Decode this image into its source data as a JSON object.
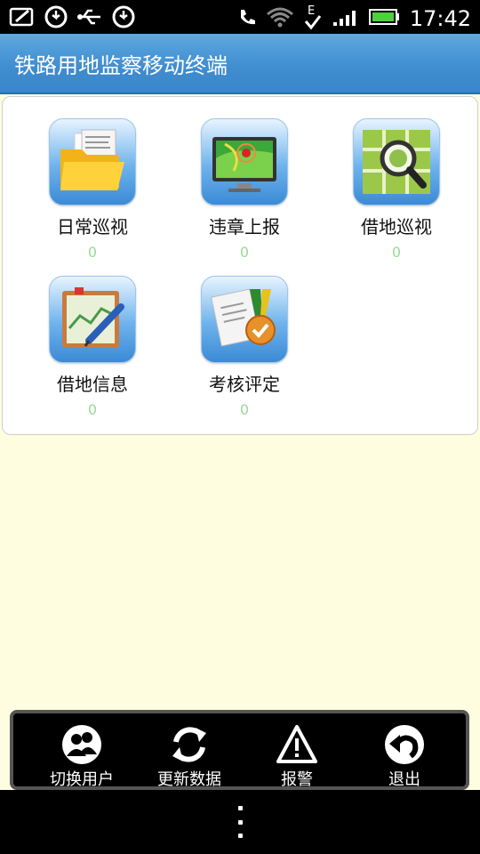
{
  "status_bar": {
    "time": "17:42",
    "icons": [
      "note-icon",
      "sync-icon",
      "usb-icon",
      "sync-icon",
      "call-icon",
      "wifi-icon",
      "edge-icon",
      "signal-icon",
      "battery-icon"
    ]
  },
  "header": {
    "title": "铁路用地监察移动终端"
  },
  "menu": {
    "items": [
      {
        "label": "日常巡视",
        "count": "0",
        "icon": "folder-icon"
      },
      {
        "label": "违章上报",
        "count": "0",
        "icon": "monitor-map-icon"
      },
      {
        "label": "借地巡视",
        "count": "0",
        "icon": "map-search-icon"
      },
      {
        "label": "借地信息",
        "count": "0",
        "icon": "chart-pen-icon"
      },
      {
        "label": "考核评定",
        "count": "0",
        "icon": "medal-icon"
      }
    ]
  },
  "toolbar": {
    "switch_user": "切换用户",
    "update_data": "更新数据",
    "alarm": "报警",
    "exit": "退出"
  }
}
